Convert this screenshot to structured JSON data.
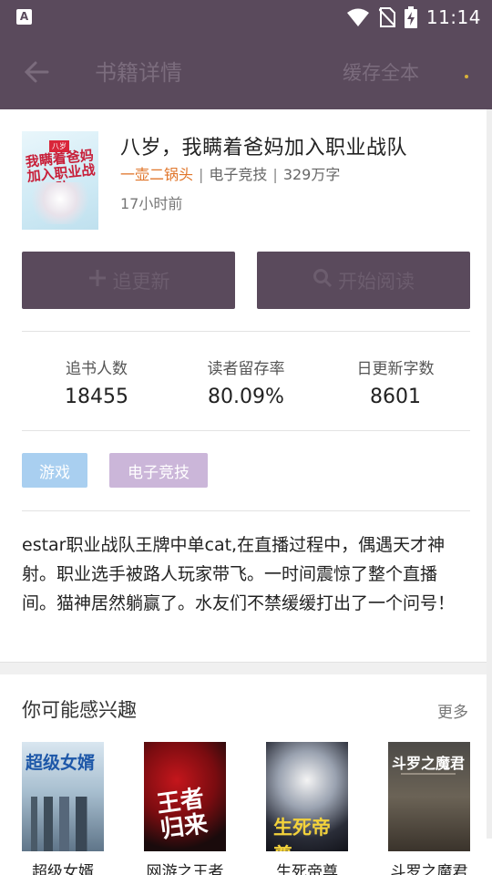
{
  "status_bar": {
    "time": "11:14",
    "app_icon": "A"
  },
  "app_bar": {
    "back_icon": "arrow-left-icon",
    "title": "书籍详情",
    "cache_all": "缓存全本"
  },
  "book": {
    "cover_badge": "八岁",
    "cover_title": "我瞒着爸妈加入职业战队",
    "title": "八岁，我瞒着爸妈加入职业战队",
    "author": "一壶二锅头",
    "sep1": "|",
    "category": "电子竞技",
    "sep2": "|",
    "word_count": "329万字",
    "updated": "17小时前"
  },
  "actions": {
    "follow_label": "追更新",
    "read_label": "开始阅读"
  },
  "stats": [
    {
      "label": "追书人数",
      "value": "18455"
    },
    {
      "label": "读者留存率",
      "value": "80.09%"
    },
    {
      "label": "日更新字数",
      "value": "8601"
    }
  ],
  "tags": [
    "游戏",
    "电子竞技"
  ],
  "intro": "estar职业战队王牌中单cat,在直播过程中，偶遇天才神射。职业选手被路人玩家带飞。一时间震惊了整个直播间。猫神居然躺赢了。水友们不禁缓缓打出了一个问号！",
  "recommend": {
    "title": "你可能感兴趣",
    "more": "更多",
    "books": [
      {
        "name": "超级女婿",
        "cover_text": "超级女婿"
      },
      {
        "name": "网游之王者",
        "cover_text": "王者归来"
      },
      {
        "name": "生死帝尊",
        "cover_text": "生死帝尊"
      },
      {
        "name": "斗罗之魔君",
        "cover_text": "斗罗之魔君"
      }
    ]
  },
  "colors": {
    "primary": "#5a4a5c",
    "author": "#e0762b",
    "tag_game": "#a9cff0",
    "tag_esports": "#cbb6d9"
  }
}
